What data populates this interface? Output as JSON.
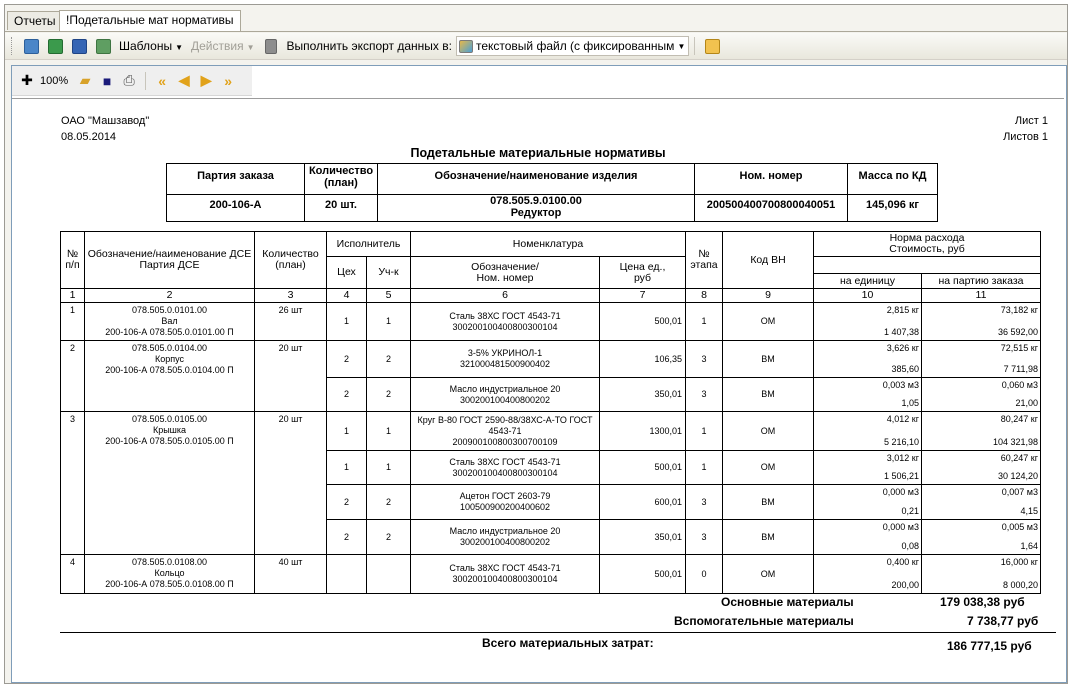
{
  "tabs": [
    "Отчеты",
    "!Подетальные мат нормативы"
  ],
  "toolbar": {
    "templates": "Шаблоны",
    "actions": "Действия",
    "export_label": "Выполнить экспорт данных в:",
    "export_format": "текстовый файл (с фиксированным"
  },
  "viewer": {
    "zoom": "100%"
  },
  "report": {
    "company": "ОАО \"Машзавод\"",
    "date": "08.05.2014",
    "sheet": "Лист 1",
    "sheets": "Листов 1",
    "title": "Подетальные материальные нормативы",
    "info_headers": [
      "Партия заказа",
      "Количество\n(план)",
      "Обозначение/наименование изделия",
      "Ном. номер",
      "Масса по КД"
    ],
    "info_values": [
      "200-106-А",
      "20 шт.",
      "078.505.9.0100.00",
      "20050040070080004005 1",
      "145,096 кг"
    ],
    "info_product_name": "Редуктор",
    "info_nom": "200500400700800040051",
    "columns": {
      "num": "№\nп/п",
      "dse": "Обозначение/наименование ДСЕ\nПартия ДСЕ",
      "qty": "Количество\n(план)",
      "executor": "Исполнитель",
      "shop": "Цех",
      "section": "Уч-к",
      "nomenclature": "Номенклатура",
      "nom_name": "Обозначение/\nНом. номер",
      "price": "Цена ед.,\nруб",
      "stage": "№\nэтапа",
      "code": "Код ВН",
      "norm": "Норма расхода\nСтоимость, руб",
      "per_unit": "на единицу",
      "per_batch": "на партию заказа",
      "indices": [
        "1",
        "2",
        "3",
        "4",
        "5",
        "6",
        "7",
        "8",
        "9",
        "10",
        "11"
      ]
    },
    "items": [
      {
        "num": "1",
        "code": "078.505.0.0101.00",
        "name": "Вал",
        "batch": "200-106-А 078.505.0.0101.00  П",
        "qty": "26 шт",
        "rows": [
          {
            "shop": "1",
            "sec": "1",
            "mat": "Сталь 38ХС ГОСТ 4543-71",
            "nom": "300200100400800300104",
            "price": "500,01",
            "stage": "1",
            "vn": "ОМ",
            "u1": "2,815 кг",
            "u2": "1 407,38",
            "b1": "73,182 кг",
            "b2": "36 592,00"
          }
        ]
      },
      {
        "num": "2",
        "code": "078.505.0.0104.00",
        "name": "Корпус",
        "batch": "200-106-А 078.505.0.0104.00  П",
        "qty": "20 шт",
        "rows": [
          {
            "shop": "2",
            "sec": "2",
            "mat": "3-5% УКРИНОЛ-1",
            "nom": "321000481500900402",
            "price": "106,35",
            "stage": "3",
            "vn": "ВМ",
            "u1": "3,626 кг",
            "u2": "385,60",
            "b1": "72,515 кг",
            "b2": "7 711,98"
          },
          {
            "shop": "2",
            "sec": "2",
            "mat": "Масло индустриальное 20",
            "nom": "300200100400800202",
            "price": "350,01",
            "stage": "3",
            "vn": "ВМ",
            "u1": "0,003 м3",
            "u2": "1,05",
            "b1": "0,060 м3",
            "b2": "21,00"
          }
        ]
      },
      {
        "num": "3",
        "code": "078.505.0.0105.00",
        "name": "Крышка",
        "batch": "200-106-А 078.505.0.0105.00  П",
        "qty": "20 шт",
        "rows": [
          {
            "shop": "1",
            "sec": "1",
            "mat": "Круг В-80 ГОСТ 2590-88/38ХС-А-ТО ГОСТ 4543-71",
            "nom": "200900100800300700109",
            "price": "1300,01",
            "stage": "1",
            "vn": "ОМ",
            "u1": "4,012 кг",
            "u2": "5 216,10",
            "b1": "80,247 кг",
            "b2": "104 321,98"
          },
          {
            "shop": "1",
            "sec": "1",
            "mat": "Сталь 38ХС ГОСТ 4543-71",
            "nom": "300200100400800300104",
            "price": "500,01",
            "stage": "1",
            "vn": "ОМ",
            "u1": "3,012 кг",
            "u2": "1 506,21",
            "b1": "60,247 кг",
            "b2": "30 124,20"
          },
          {
            "shop": "2",
            "sec": "2",
            "mat": "Ацетон ГОСТ 2603-79",
            "nom": "100500900200400602",
            "price": "600,01",
            "stage": "3",
            "vn": "ВМ",
            "u1": "0,000 м3",
            "u2": "0,21",
            "b1": "0,007 м3",
            "b2": "4,15"
          },
          {
            "shop": "2",
            "sec": "2",
            "mat": "Масло индустриальное 20",
            "nom": "300200100400800202",
            "price": "350,01",
            "stage": "3",
            "vn": "ВМ",
            "u1": "0,000 м3",
            "u2": "0,08",
            "b1": "0,005 м3",
            "b2": "1,64"
          }
        ]
      },
      {
        "num": "4",
        "code": "078.505.0.0108.00",
        "name": "Кольцо",
        "batch": "200-106-А 078.505.0.0108.00  П",
        "qty": "40 шт",
        "rows": [
          {
            "shop": "",
            "sec": "",
            "mat": "Сталь 38ХС ГОСТ 4543-71",
            "nom": "300200100400800300104",
            "price": "500,01",
            "stage": "0",
            "vn": "ОМ",
            "u1": "0,400 кг",
            "u2": "200,00",
            "b1": "16,000 кг",
            "b2": "8 000,20"
          }
        ]
      }
    ],
    "totals": {
      "main_label": "Основные материалы",
      "main_value": "179 038,38 руб",
      "aux_label": "Вспомогательные материалы",
      "aux_value": "7 738,77 руб",
      "all_label": "Всего материальных затрат:",
      "all_value": "186 777,15 руб"
    }
  }
}
